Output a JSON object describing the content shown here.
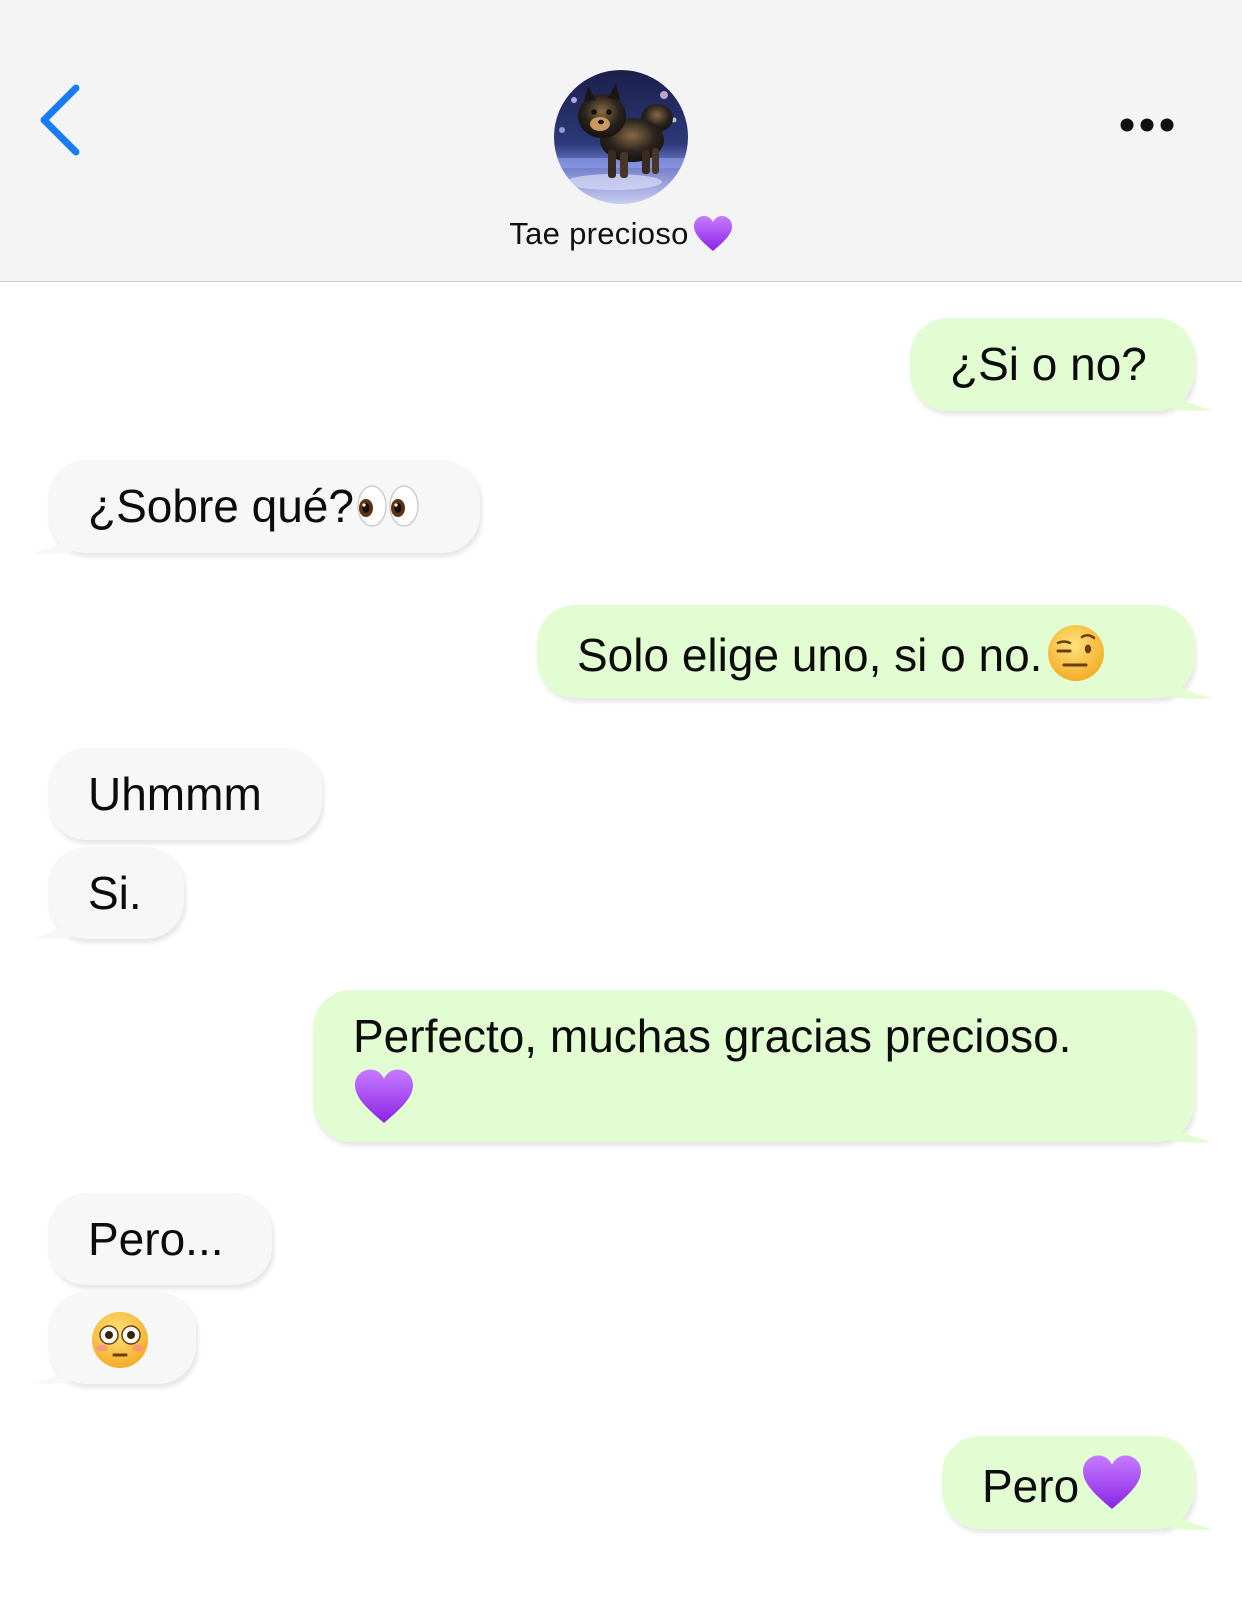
{
  "header": {
    "contact_name": "Tae precioso",
    "name_emoji": "purple-heart-icon"
  },
  "messages": [
    {
      "side": "out",
      "text": "¿Si o no?",
      "emoji": ""
    },
    {
      "side": "in",
      "text": "¿Sobre qué?",
      "emoji": "eyes-emoji"
    },
    {
      "side": "out",
      "text": "Solo elige uno, si o no.",
      "emoji": "raised-eyebrow-face-emoji"
    },
    {
      "side": "in",
      "text": "Uhmmm",
      "emoji": ""
    },
    {
      "side": "in",
      "text": "Si.",
      "emoji": ""
    },
    {
      "side": "out",
      "text": "Perfecto, muchas gracias precioso.",
      "emoji": "purple-heart-emoji"
    },
    {
      "side": "in",
      "text": "Pero...",
      "emoji": ""
    },
    {
      "side": "in",
      "text": "",
      "emoji": "flushed-face-emoji"
    },
    {
      "side": "out",
      "text": "Pero",
      "emoji": "purple-heart-emoji"
    }
  ],
  "colors": {
    "outgoing_bubble": "#e2fdd1",
    "incoming_bubble": "#f7f7f7",
    "accent_blue": "#1a7cf5",
    "header_bg": "#f4f4f4",
    "heart_purple": "#9b3cf0"
  }
}
